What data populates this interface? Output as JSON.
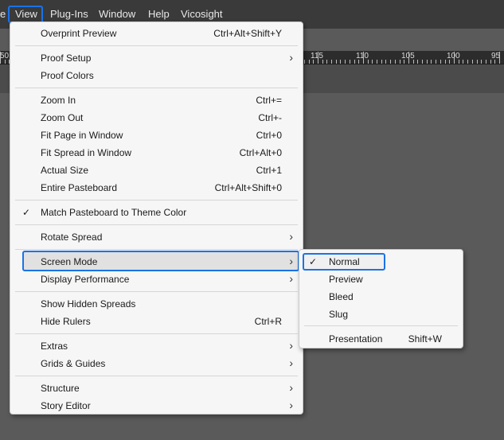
{
  "menubar": {
    "prev_fragment": "e",
    "items": [
      "View",
      "Plug-Ins",
      "Window",
      "Help",
      "Vicosight"
    ]
  },
  "ruler": {
    "labels": [
      "50",
      "115",
      "110",
      "105",
      "100",
      "95"
    ]
  },
  "view_menu": {
    "items": [
      {
        "label": "Overprint Preview",
        "shortcut": "Ctrl+Alt+Shift+Y"
      },
      {
        "label": "Proof Setup",
        "submenu": true
      },
      {
        "label": "Proof Colors"
      },
      {
        "label": "Zoom In",
        "shortcut": "Ctrl+="
      },
      {
        "label": "Zoom Out",
        "shortcut": "Ctrl+-"
      },
      {
        "label": "Fit Page in Window",
        "shortcut": "Ctrl+0"
      },
      {
        "label": "Fit Spread in Window",
        "shortcut": "Ctrl+Alt+0"
      },
      {
        "label": "Actual Size",
        "shortcut": "Ctrl+1"
      },
      {
        "label": "Entire Pasteboard",
        "shortcut": "Ctrl+Alt+Shift+0"
      },
      {
        "label": "Match Pasteboard to Theme Color",
        "checked": true
      },
      {
        "label": "Rotate Spread",
        "submenu": true
      },
      {
        "label": "Screen Mode",
        "submenu": true,
        "highlighted": true
      },
      {
        "label": "Display Performance",
        "submenu": true
      },
      {
        "label": "Show Hidden Spreads"
      },
      {
        "label": "Hide Rulers",
        "shortcut": "Ctrl+R"
      },
      {
        "label": "Extras",
        "submenu": true
      },
      {
        "label": "Grids & Guides",
        "submenu": true
      },
      {
        "label": "Structure",
        "submenu": true
      },
      {
        "label": "Story Editor",
        "submenu": true
      }
    ]
  },
  "screen_mode_submenu": {
    "items": [
      {
        "label": "Normal",
        "checked": true,
        "highlighted": true
      },
      {
        "label": "Preview"
      },
      {
        "label": "Bleed"
      },
      {
        "label": "Slug"
      },
      {
        "label": "Presentation",
        "shortcut": "Shift+W"
      }
    ]
  },
  "glyphs": {
    "check": "✓",
    "chevron": "›"
  },
  "colors": {
    "highlight_border": "#1a73e8",
    "menu_bg": "#f6f6f6",
    "menubar_bg": "#3a3a3a"
  }
}
